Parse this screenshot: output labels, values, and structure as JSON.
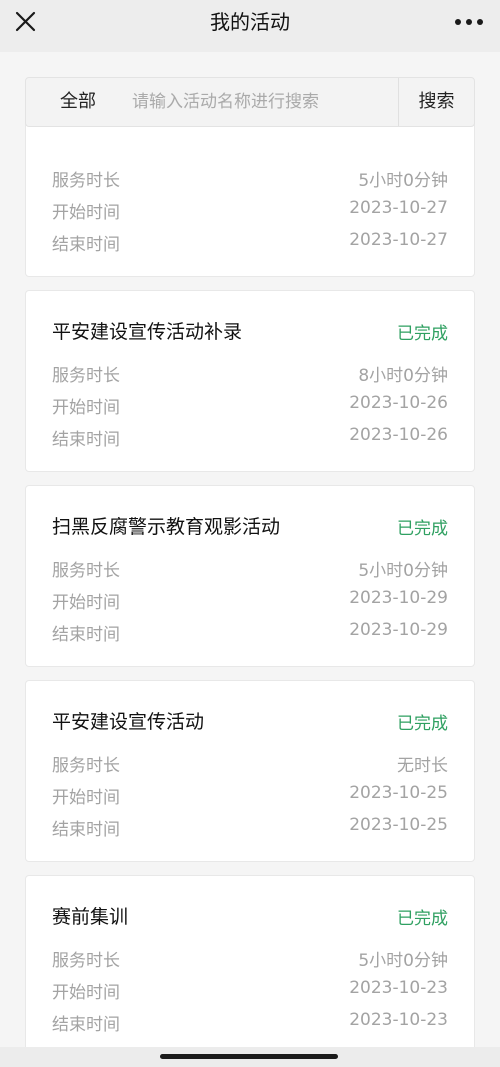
{
  "nav": {
    "title": "我的活动",
    "close_icon": "close-x-icon",
    "more_icon": "more-dots-icon"
  },
  "search": {
    "filter_label": "全部",
    "placeholder": "请输入活动名称进行搜索",
    "value": "",
    "button_label": "搜索"
  },
  "labels": {
    "duration": "服务时长",
    "start": "开始时间",
    "end": "结束时间"
  },
  "colors": {
    "status_green": "#2fa061",
    "muted_text": "#a3a3a3"
  },
  "activities": [
    {
      "title": "",
      "status": "",
      "duration": "5小时0分钟",
      "start": "2023-10-27",
      "end": "2023-10-27"
    },
    {
      "title": "平安建设宣传活动补录",
      "status": "已完成",
      "duration": "8小时0分钟",
      "start": "2023-10-26",
      "end": "2023-10-26"
    },
    {
      "title": "扫黑反腐警示教育观影活动",
      "status": "已完成",
      "duration": "5小时0分钟",
      "start": "2023-10-29",
      "end": "2023-10-29"
    },
    {
      "title": "平安建设宣传活动",
      "status": "已完成",
      "duration": "无时长",
      "start": "2023-10-25",
      "end": "2023-10-25"
    },
    {
      "title": "赛前集训",
      "status": "已完成",
      "duration": "5小时0分钟",
      "start": "2023-10-23",
      "end": "2023-10-23"
    }
  ]
}
